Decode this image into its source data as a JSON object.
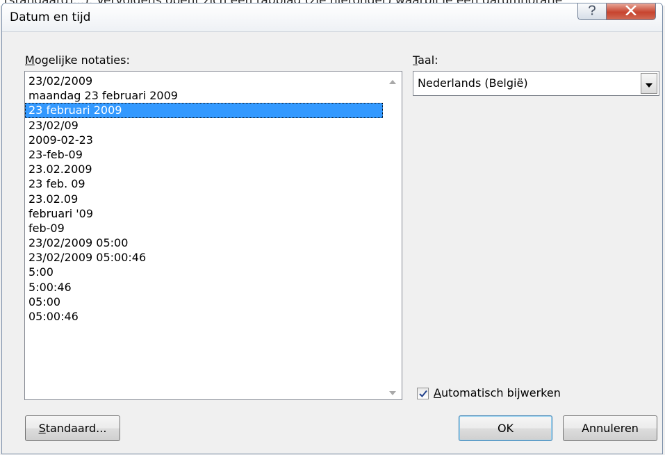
{
  "window": {
    "partial_top_text": "[standaard]...). Vervolgens opent zich een tabblad (zie hieronder) waarbij je een datumnotatie",
    "title": "Datum en tijd"
  },
  "formats": {
    "label_mnemonic": "M",
    "label_rest": "ogelijke notaties:",
    "selected_index": 2,
    "items": [
      "23/02/2009",
      "maandag 23 februari 2009",
      "23 februari 2009",
      "23/02/09",
      "2009-02-23",
      "23-feb-09",
      "23.02.2009",
      "23 feb. 09",
      "23.02.09",
      "februari '09",
      "feb-09",
      "23/02/2009 05:00",
      "23/02/2009 05:00:46",
      "5:00",
      "5:00:46",
      "05:00",
      "05:00:46"
    ]
  },
  "language": {
    "label_mnemonic": "T",
    "label_rest": "aal:",
    "value": "Nederlands (België)"
  },
  "auto_update": {
    "checked": true,
    "label_mnemonic": "A",
    "label_rest": "utomatisch bijwerken"
  },
  "buttons": {
    "default_mnemonic": "S",
    "default_rest": "tandaard...",
    "ok": "OK",
    "cancel": "Annuleren"
  },
  "colors": {
    "selection": "#3399ff",
    "close_button": "#c7442f"
  }
}
